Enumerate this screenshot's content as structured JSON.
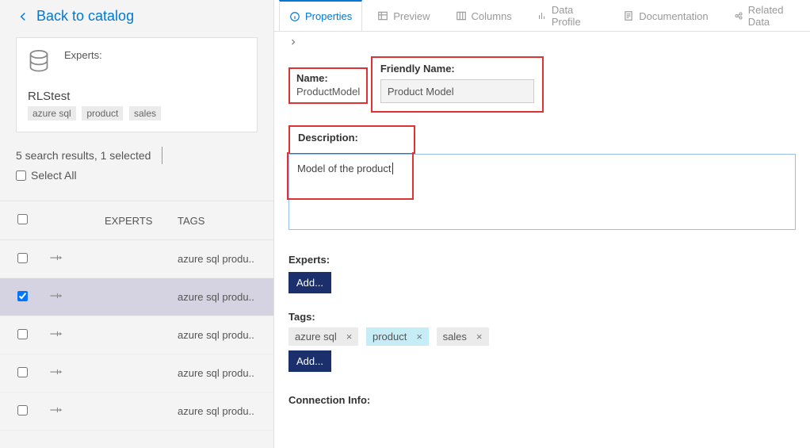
{
  "header": {
    "back_label": "Back to catalog"
  },
  "asset_card": {
    "experts_label": "Experts:",
    "name": "RLStest",
    "tags": [
      "azure sql",
      "product",
      "sales"
    ]
  },
  "results": {
    "summary": "5 search results, 1 selected",
    "select_all_label": "Select All",
    "columns": {
      "experts": "EXPERTS",
      "tags": "TAGS"
    },
    "rows": [
      {
        "selected": false,
        "tags_preview": "azure sql produ.."
      },
      {
        "selected": true,
        "tags_preview": "azure sql produ.."
      },
      {
        "selected": false,
        "tags_preview": "azure sql produ.."
      },
      {
        "selected": false,
        "tags_preview": "azure sql produ.."
      },
      {
        "selected": false,
        "tags_preview": "azure sql produ.."
      }
    ]
  },
  "tabs": [
    {
      "id": "properties",
      "label": "Properties",
      "icon": "info-icon",
      "active": true
    },
    {
      "id": "preview",
      "label": "Preview",
      "icon": "table-icon",
      "active": false
    },
    {
      "id": "columns",
      "label": "Columns",
      "icon": "columns-icon",
      "active": false
    },
    {
      "id": "dataprofile",
      "label": "Data Profile",
      "icon": "bars-icon",
      "active": false
    },
    {
      "id": "documentation",
      "label": "Documentation",
      "icon": "doc-icon",
      "active": false
    },
    {
      "id": "related",
      "label": "Related Data",
      "icon": "link-icon",
      "active": false
    }
  ],
  "properties": {
    "name_label": "Name:",
    "name_value": "ProductModel",
    "friendly_label": "Friendly Name:",
    "friendly_value": "Product Model",
    "description_label": "Description:",
    "description_value": "Model of the product",
    "experts_label": "Experts:",
    "experts_add": "Add...",
    "tags_label": "Tags:",
    "tags_add": "Add...",
    "tags": [
      {
        "label": "azure sql",
        "selected": false
      },
      {
        "label": "product",
        "selected": true
      },
      {
        "label": "sales",
        "selected": false
      }
    ],
    "connection_label": "Connection Info:"
  }
}
